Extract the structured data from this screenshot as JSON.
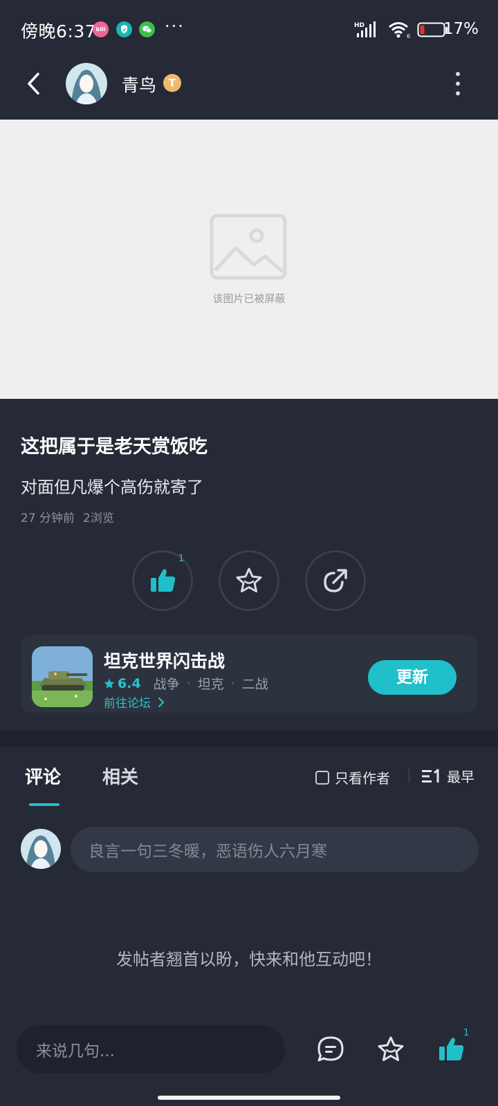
{
  "status_bar": {
    "time": "傍晚6:37",
    "app_icons": [
      "bilibili-icon",
      "shield-icon",
      "wechat-icon"
    ],
    "more": "···",
    "network": "HD",
    "battery": "17%"
  },
  "header": {
    "username": "青鸟",
    "badge_letter": "T"
  },
  "post": {
    "image_blocked_text": "该图片已被屏蔽",
    "title": "这把属于是老天赏饭吃",
    "body": "对面但凡爆个高伤就寄了",
    "time": "27 分钟前",
    "views": "2浏览",
    "like_count": "1"
  },
  "game_card": {
    "name": "坦克世界闪击战",
    "score": "6.4",
    "tags": [
      "战争",
      "坦克",
      "二战"
    ],
    "forum_link": "前往论坛",
    "button": "更新"
  },
  "comments": {
    "tabs": [
      "评论",
      "相关"
    ],
    "author_only": "只看作者",
    "sort": "最早",
    "input_placeholder": "良言一句三冬暖，恶语伤人六月寒",
    "empty_hint": "发帖者翘首以盼，快来和他互动吧！"
  },
  "bottom_bar": {
    "input_placeholder": "来说几句...",
    "like_count": "1"
  },
  "colors": {
    "background": "#262a36",
    "accent": "#1fc0c9",
    "card": "#2d323f"
  }
}
